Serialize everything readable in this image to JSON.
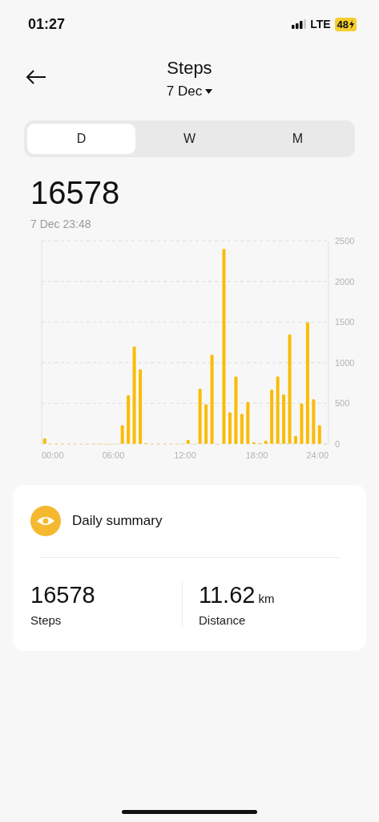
{
  "status_bar": {
    "time": "01:27",
    "network": "LTE",
    "battery": "48"
  },
  "header": {
    "title": "Steps",
    "date": "7 Dec"
  },
  "tabs": [
    {
      "label": "D",
      "selected": true
    },
    {
      "label": "W",
      "selected": false
    },
    {
      "label": "M",
      "selected": false
    }
  ],
  "total": {
    "value": "16578",
    "timestamp": "7 Dec 23:48"
  },
  "chart_data": {
    "type": "bar",
    "grid": true,
    "x": [
      0.25,
      0.75,
      1.25,
      1.75,
      2.25,
      2.75,
      3.25,
      3.75,
      4.25,
      4.75,
      5.25,
      5.75,
      6.25,
      6.75,
      7.25,
      7.75,
      8.25,
      8.75,
      9.25,
      9.75,
      10.25,
      10.75,
      11.25,
      11.75,
      12.25,
      12.75,
      13.25,
      13.75,
      14.25,
      14.75,
      15.25,
      15.75,
      16.25,
      16.75,
      17.25,
      17.75,
      18.25,
      18.75,
      19.25,
      19.75,
      20.25,
      20.75,
      21.25,
      21.75,
      22.25,
      22.75,
      23.25,
      23.75
    ],
    "series": [
      {
        "color": "#fbbc05",
        "values": [
          70,
          0,
          0,
          0,
          0,
          0,
          0,
          0,
          0,
          0,
          0,
          0,
          0,
          230,
          600,
          1200,
          920,
          10,
          0,
          0,
          0,
          0,
          0,
          0,
          50,
          0,
          680,
          490,
          1100,
          0,
          2400,
          390,
          830,
          370,
          520,
          20,
          10,
          40,
          670,
          830,
          610,
          1350,
          100,
          500,
          1500,
          550,
          230,
          0
        ]
      }
    ],
    "xlim": [
      0,
      24
    ],
    "ylim": [
      0,
      2500
    ],
    "xticks": [
      {
        "value": 0,
        "label": "00:00"
      },
      {
        "value": 6,
        "label": "06:00"
      },
      {
        "value": 12,
        "label": "12:00"
      },
      {
        "value": 18,
        "label": "18:00"
      },
      {
        "value": 24,
        "label": "24:00"
      }
    ],
    "yticks": [
      0,
      500,
      1000,
      1500,
      2000,
      2500
    ]
  },
  "summary": {
    "title": "Daily summary",
    "stats": [
      {
        "value": "16578",
        "label": "Steps"
      },
      {
        "value": "11.62",
        "unit": "km",
        "label": "Distance"
      }
    ]
  }
}
